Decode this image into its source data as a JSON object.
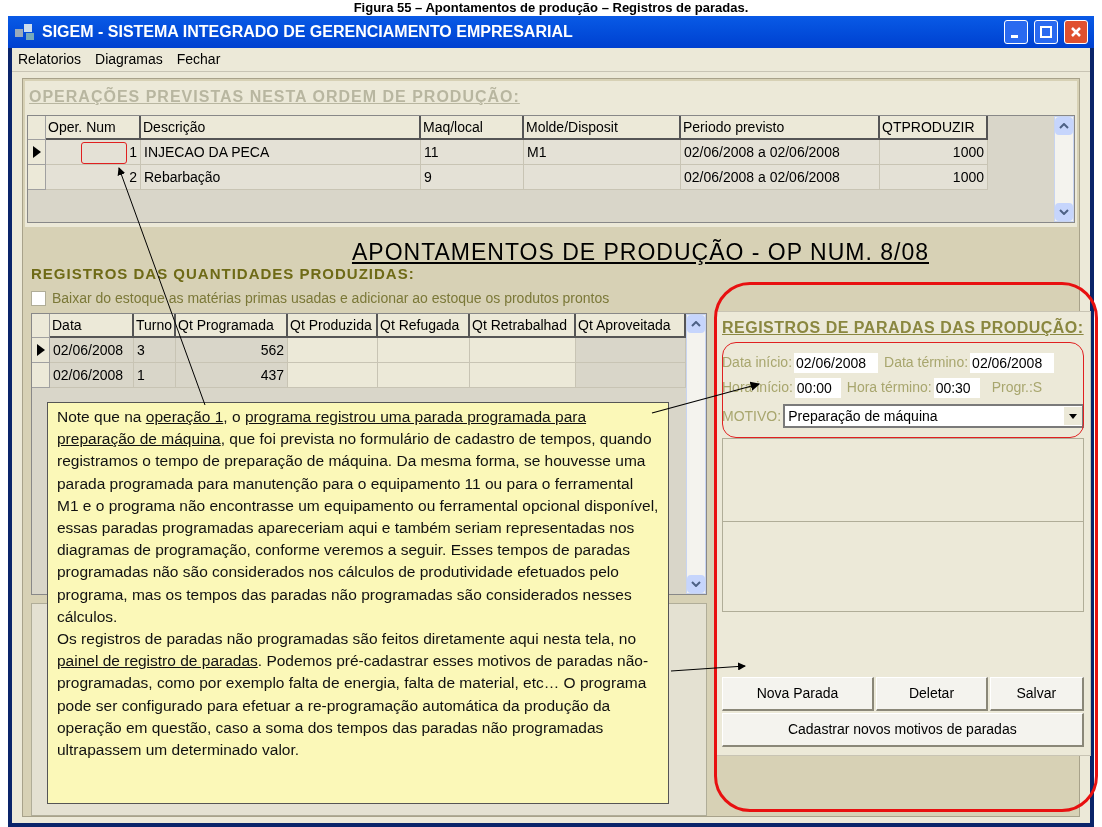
{
  "caption": "Figura 55 – Apontamentos de produção – Registros de paradas.",
  "window": {
    "title": "SIGEM - SISTEMA INTEGRADO DE GERENCIAMENTO EMPRESARIAL"
  },
  "menu": [
    "Relatorios",
    "Diagramas",
    "Fechar"
  ],
  "operations": {
    "title": "OPERAÇÕES PREVISTAS NESTA ORDEM DE PRODUÇÃO:",
    "columns": [
      "Oper. Num",
      "Descrição",
      "Maq/local",
      "Molde/Disposit",
      "Periodo previsto",
      "QTPRODUZIR"
    ],
    "rows": [
      {
        "selected": true,
        "cells": [
          "1",
          "INJECAO DA PECA",
          "11",
          "M1",
          "02/06/2008 a 02/06/2008",
          "1000"
        ]
      },
      {
        "selected": false,
        "cells": [
          "2",
          "Rebarbação",
          "9",
          "",
          "02/06/2008 a 02/06/2008",
          "1000"
        ]
      }
    ]
  },
  "production": {
    "title": "APONTAMENTOS DE PRODUÇÃO - OP NUM. 8/08",
    "section_title": "REGISTROS DAS QUANTIDADES PRODUZIDAS:",
    "checkbox": {
      "label": "Baixar do estoque as matérias primas usadas e adicionar ao estoque os produtos prontos",
      "checked": false
    },
    "columns": [
      "Data",
      "Turno",
      "Qt Programada",
      "Qt Produzida",
      "Qt Refugada",
      "Qt Retrabalhad",
      "Qt Aproveitada"
    ],
    "rows": [
      {
        "selected": true,
        "cells": [
          "02/06/2008",
          "3",
          "562",
          "",
          "",
          "",
          ""
        ]
      },
      {
        "selected": false,
        "cells": [
          "02/06/2008",
          "1",
          "437",
          "",
          "",
          "",
          ""
        ]
      }
    ]
  },
  "stops": {
    "title": "REGISTROS DE PARADAS DAS PRODUÇÃO:",
    "date_start": {
      "label": "Data início:",
      "value": "02/06/2008"
    },
    "date_end": {
      "label": "Data término:",
      "value": "02/06/2008"
    },
    "time_start": {
      "label": "Hora início:",
      "value": "00:00"
    },
    "time_end": {
      "label": "Hora término:",
      "value": "00:30"
    },
    "progr": "Progr.:S",
    "reason": {
      "label": "MOTIVO:",
      "value": "Preparação de máquina"
    },
    "buttons": [
      "Nova Parada",
      "Deletar",
      "Salvar"
    ],
    "wide_button": "Cadastrar novos motivos de paradas"
  },
  "note": {
    "paragraphs": [
      [
        {
          "text": "Note que na ",
          "underlined": false
        },
        {
          "text": "operação 1",
          "underlined": true
        },
        {
          "text": ", o ",
          "underlined": false
        },
        {
          "text": "programa registrou uma parada programada para preparação de máquina",
          "underlined": true
        },
        {
          "text": ", que foi prevista no formulário de cadastro de tempos, quando registramos o tempo de preparação de máquina. Da mesma forma, se houvesse uma parada programada para manutenção para o equipamento 11 ou para o ferramental M1 e o programa não encontrasse um equipamento ou ferramental opcional disponível, essas paradas programadas apareceriam aqui e também seriam representadas nos diagramas de programação, conforme veremos a seguir. Esses tempos de paradas programadas não são considerados nos cálculos de produtividade efetuados pelo programa, mas os tempos das paradas não programadas são considerados nesses cálculos.",
          "underlined": false
        }
      ],
      [
        {
          "text": "Os registros de paradas não programadas são feitos diretamente aqui nesta tela, no ",
          "underlined": false
        },
        {
          "text": "painel de registro de paradas",
          "underlined": true
        },
        {
          "text": ". Podemos pré-cadastrar esses motivos de paradas não-programadas, como por exemplo falta de energia, falta de material, etc… O programa pode ser configurado para efetuar a re-programação automática da produção da operação em questão, caso a soma dos tempos das paradas não programadas ultrapassem um determinado valor.",
          "underlined": false
        }
      ]
    ]
  }
}
